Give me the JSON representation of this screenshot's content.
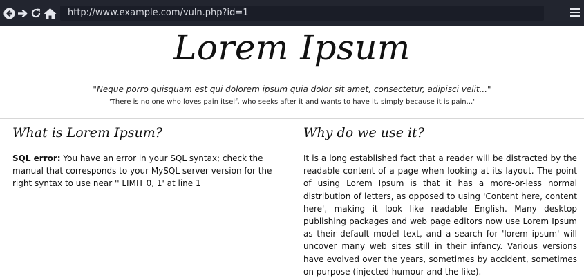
{
  "browser": {
    "url": "http://www.example.com/vuln.php?id=1",
    "icons": [
      "back-icon",
      "forward-icon",
      "reload-icon",
      "home-icon",
      "menu-icon"
    ]
  },
  "page": {
    "title": "Lorem Ipsum",
    "quote_latin": "\"Neque porro quisquam est qui dolorem ipsum quia dolor sit amet, consectetur, adipisci velit...\"",
    "quote_english": "\"There is no one who loves pain itself, who seeks after it and wants to have it, simply because it is pain...\"",
    "left_column": {
      "heading": "What is Lorem Ipsum?",
      "error_label": "SQL error:",
      "error_message": " You have an error in your SQL syntax; check the manual that corresponds to your MySQL server version for the right syntax to use near '' LIMIT 0, 1' at line 1"
    },
    "right_column": {
      "heading": "Why do we use it?",
      "paragraph": "It is a long established fact that a reader will be distracted by the readable content of a page when looking at its layout. The point of using Lorem Ipsum is that it has a more-or-less normal distribution of letters, as opposed to using 'Content here, content here', making it look like readable English. Many desktop publishing packages and web page editors now use Lorem Ipsum as their default model text, and a search for 'lorem ipsum' will uncover many web sites still in their infancy. Various versions have evolved over the years, sometimes by accident, sometimes on purpose (injected humour and the like)."
    }
  },
  "colors": {
    "toolbar_bg": "#22252f",
    "urlbar_bg": "#1a1d27",
    "url_text": "#d8dae0",
    "page_bg": "#ffffff"
  }
}
